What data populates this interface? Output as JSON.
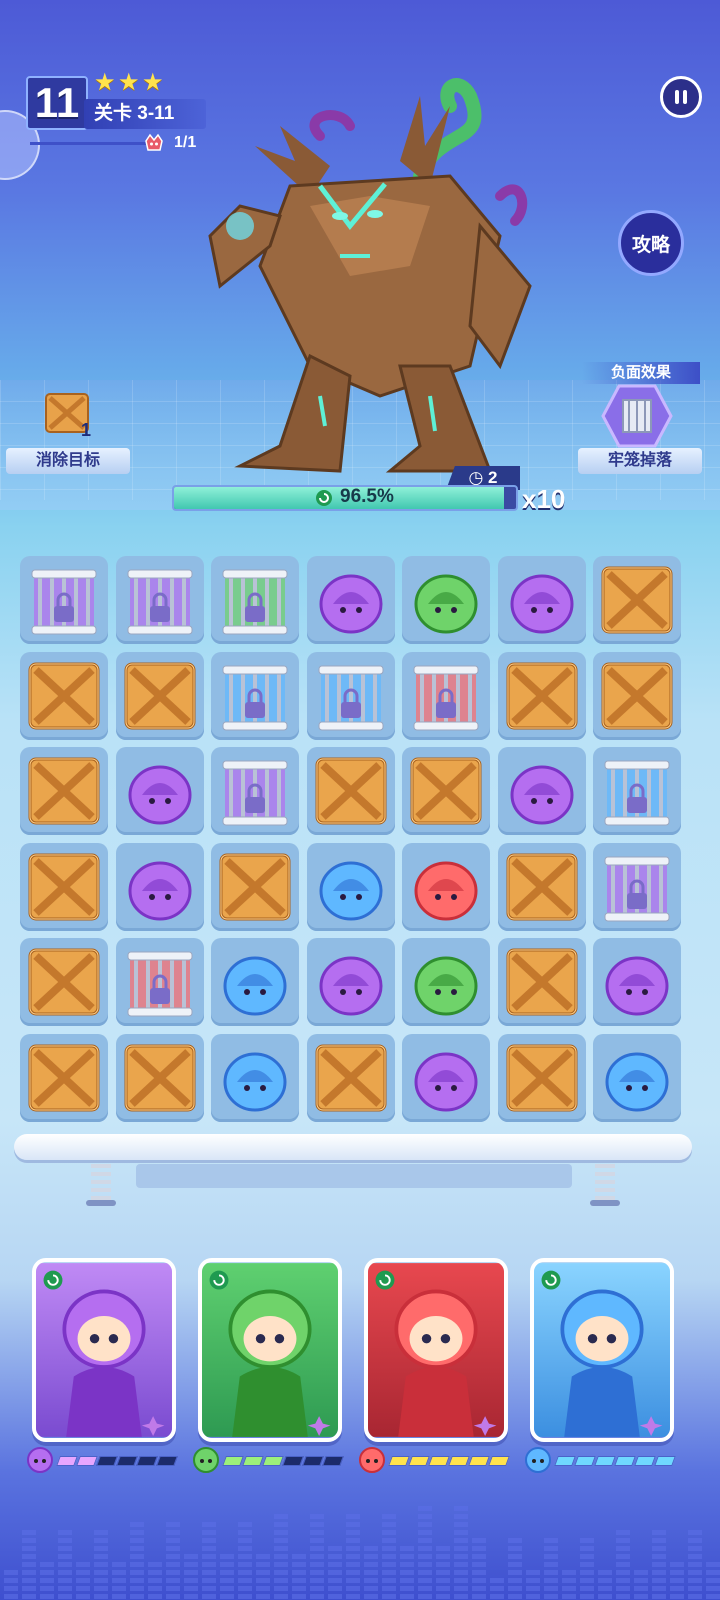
{
  "header": {
    "level_number": "11",
    "stars": 3,
    "stage_label": "关卡 3-11",
    "enemy_count": "1/1",
    "guide_button": "攻略"
  },
  "objective": {
    "label": "消除目标",
    "remaining": "1"
  },
  "debuff": {
    "title": "负面效果",
    "label": "牢笼掉落"
  },
  "boss": {
    "name_icon": "tree-golem-boss",
    "hp_percent_text": "96.5%",
    "hp_fraction": 0.965,
    "turns_left": "2",
    "multiplier": "x10"
  },
  "board": {
    "rows": 6,
    "cols": 7,
    "grid": [
      [
        "cage-purple",
        "cage-purple",
        "cage-green",
        "purple",
        "green",
        "purple",
        "crate"
      ],
      [
        "crate",
        "crate",
        "cage-blue",
        "cage-blue",
        "cage-red",
        "crate",
        "crate"
      ],
      [
        "crate",
        "purple",
        "cage-purple",
        "crate",
        "crate",
        "purple",
        "cage-blue"
      ],
      [
        "crate",
        "purple",
        "crate",
        "blue",
        "red",
        "crate",
        "cage-purple"
      ],
      [
        "crate",
        "cage-red",
        "blue",
        "purple",
        "green",
        "crate",
        "purple"
      ],
      [
        "crate",
        "crate",
        "blue",
        "crate",
        "purple",
        "crate",
        "blue"
      ]
    ]
  },
  "heroes": [
    {
      "name": "purple-hero",
      "color": "purple",
      "energy_filled": 2,
      "energy_total": 6,
      "accent": "#e7a6ff"
    },
    {
      "name": "green-hero",
      "color": "green",
      "energy_filled": 3,
      "energy_total": 6,
      "accent": "#9cf07a"
    },
    {
      "name": "red-hero",
      "color": "red",
      "energy_filled": 6,
      "energy_total": 6,
      "accent": "#ffe34d"
    },
    {
      "name": "blue-hero",
      "color": "blue",
      "energy_filled": 6,
      "energy_total": 6,
      "accent": "#6fd8ff"
    }
  ]
}
